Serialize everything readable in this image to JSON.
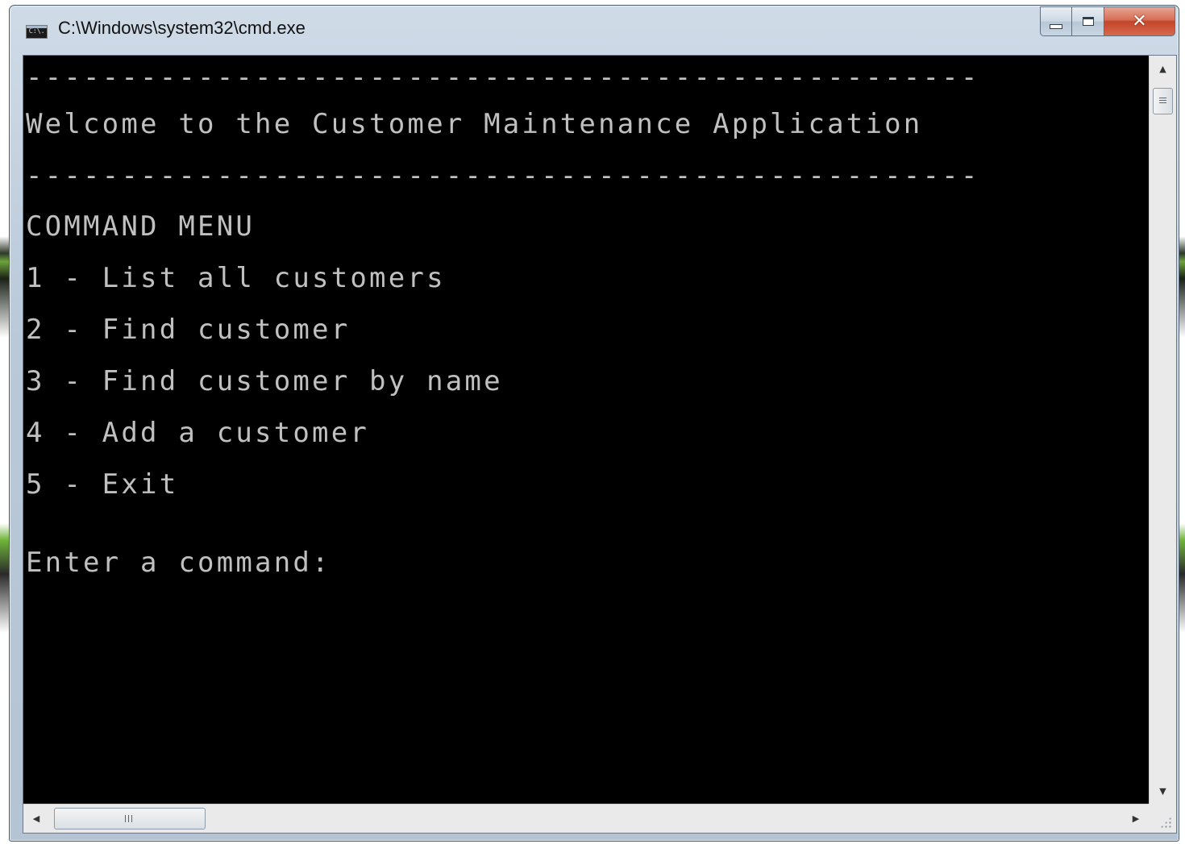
{
  "window": {
    "title": "C:\\Windows\\system32\\cmd.exe",
    "icon_label": "C:\\.",
    "buttons": {
      "minimize": "minimize-icon",
      "maximize": "maximize-icon",
      "close": "✕"
    }
  },
  "console": {
    "text_color": "#c0c0c0",
    "background": "#000000",
    "lines": {
      "rule_top": "--------------------------------------------------",
      "welcome": "Welcome to the Customer Maintenance Application",
      "rule_bottom": "--------------------------------------------------",
      "menu_title": "COMMAND MENU",
      "opt1": "1 - List all customers",
      "opt2": "2 - Find customer",
      "opt3": "3 - Find customer by name",
      "opt4": "4 - Add a customer",
      "opt5": "5 - Exit",
      "prompt": "Enter a command:"
    }
  },
  "scrollbars": {
    "up_arrow": "▲",
    "down_arrow": "▼",
    "left_arrow": "◀",
    "right_arrow": "▶"
  }
}
